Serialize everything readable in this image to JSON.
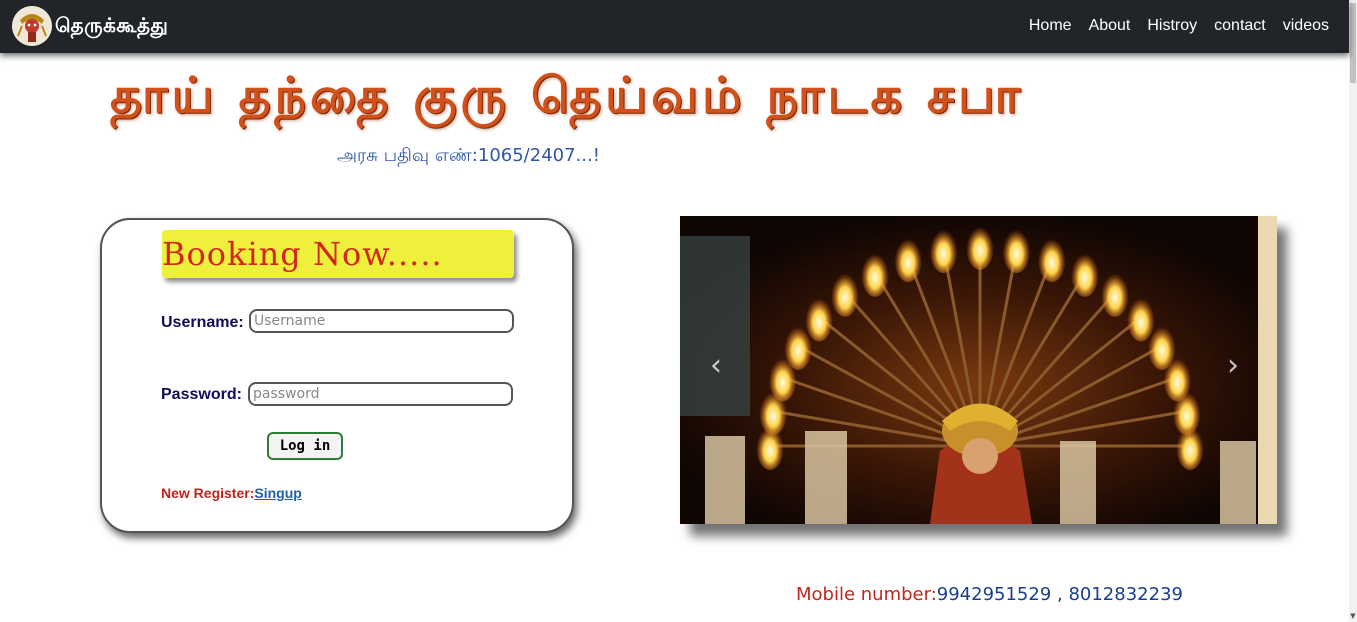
{
  "navbar": {
    "brand": "தெருக்கூத்து",
    "links": [
      "Home",
      "About",
      "Histroy",
      "contact",
      "videos"
    ]
  },
  "header": {
    "title": "தாய் தந்தை குரு தெய்வம் நாடக சபா",
    "registration": "அரசு பதிவு எண்:1065/2407...!"
  },
  "login": {
    "heading": "Booking Now.....",
    "username_label": "Username:",
    "username_placeholder": "Username",
    "password_label": "Password:",
    "password_placeholder": "password",
    "button": "Log in",
    "register_label": "New Register:",
    "register_link": "Singup"
  },
  "carousel": {
    "prev": "‹",
    "next": "›"
  },
  "contact": {
    "mobile_label": "Mobile number:",
    "mobile_value": "9942951529 , 8012832239"
  },
  "colors": {
    "navbar": "#212529",
    "title": "#d2501a",
    "booking_bg": "#eef03c",
    "booking_text": "#d2281c"
  }
}
